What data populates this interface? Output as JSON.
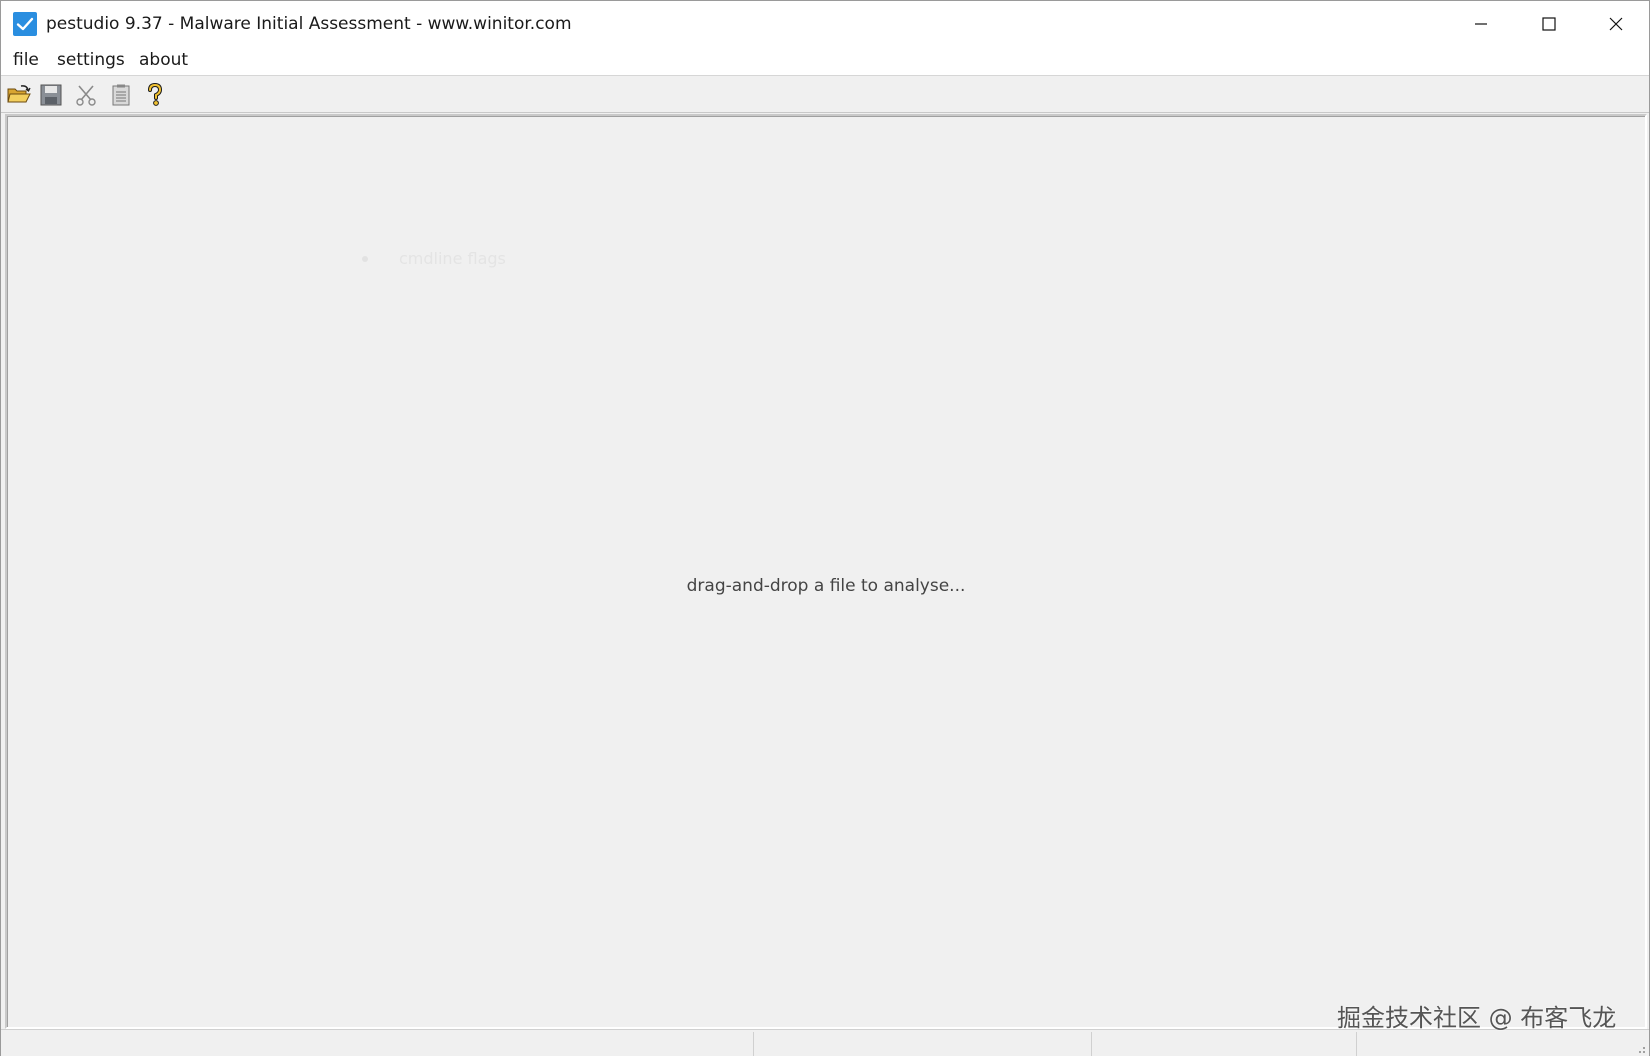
{
  "window": {
    "title": "pestudio 9.37 - Malware Initial Assessment - www.winitor.com",
    "icon": "checkmark-app-icon",
    "accent": "#2a8ee0"
  },
  "menu": {
    "file": "file",
    "settings": "settings",
    "about": "about"
  },
  "toolbar": {
    "buttons": [
      "open-folder-icon",
      "save-icon",
      "cut-icon",
      "copy-icon",
      "help-icon"
    ]
  },
  "main": {
    "faded_text": "cmdline flags",
    "drop_hint": "drag-and-drop a file to analyse..."
  },
  "watermark": "掘金技术社区 @ 布客飞龙"
}
